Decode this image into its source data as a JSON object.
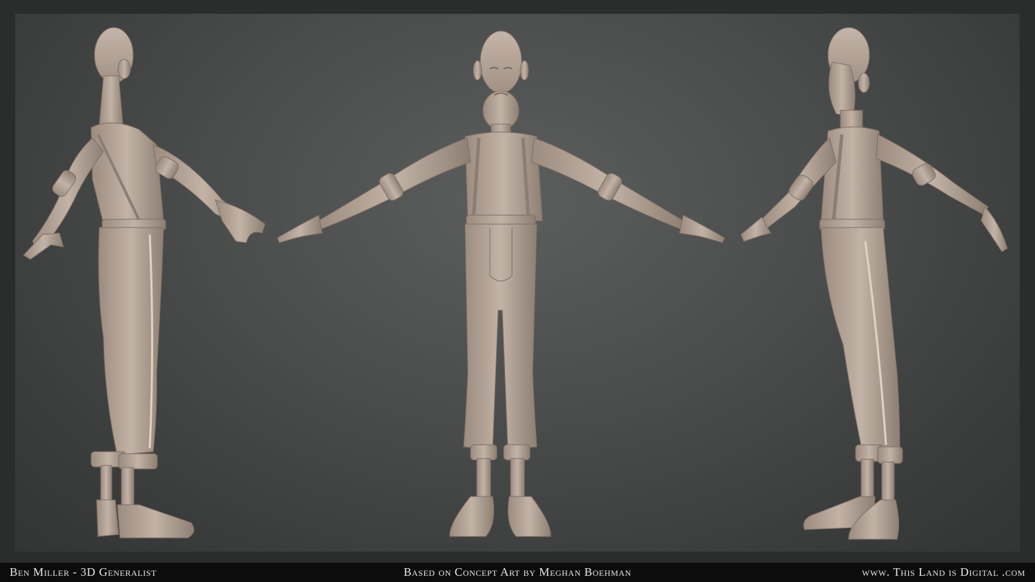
{
  "footer": {
    "credit_left": "Ben Miller - 3D Generalist",
    "credit_center": "Based on Concept Art by Meghan Boehman",
    "credit_right": "www. This Land is Digital .com"
  },
  "render": {
    "views": [
      "side-back view",
      "front view",
      "side-front view"
    ],
    "colors": {
      "background": "#4a4c4b",
      "clay": "#b7a79a",
      "clay_shadow": "#8c7d72",
      "footer_bar": "#0c0c0c",
      "footer_text": "#e9e9e9"
    }
  }
}
